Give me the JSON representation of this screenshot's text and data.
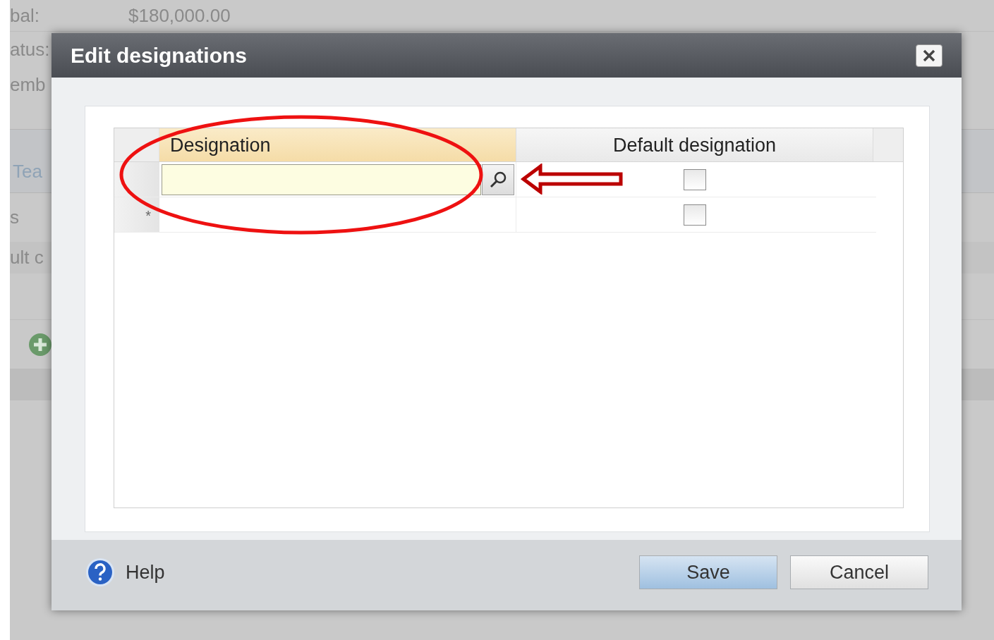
{
  "background_page": {
    "fields": [
      {
        "label": "bal:",
        "value": "$180,000.00"
      },
      {
        "label": "atus:"
      },
      {
        "label": "emb"
      }
    ],
    "tab": "Tea",
    "toolbar_text": "s",
    "column_text": "ult c"
  },
  "dialog": {
    "title": "Edit designations",
    "grid": {
      "columns": [
        {
          "label": "Designation",
          "selected": true
        },
        {
          "label": "Default designation",
          "selected": false
        }
      ],
      "rows": [
        {
          "marker": "",
          "editing": true,
          "default_checked": false
        },
        {
          "marker": "*",
          "editing": false,
          "default_checked": false
        }
      ]
    },
    "help": "Help",
    "buttons": [
      {
        "label": "Save",
        "primary": true
      },
      {
        "label": "Cancel",
        "primary": false
      }
    ]
  }
}
